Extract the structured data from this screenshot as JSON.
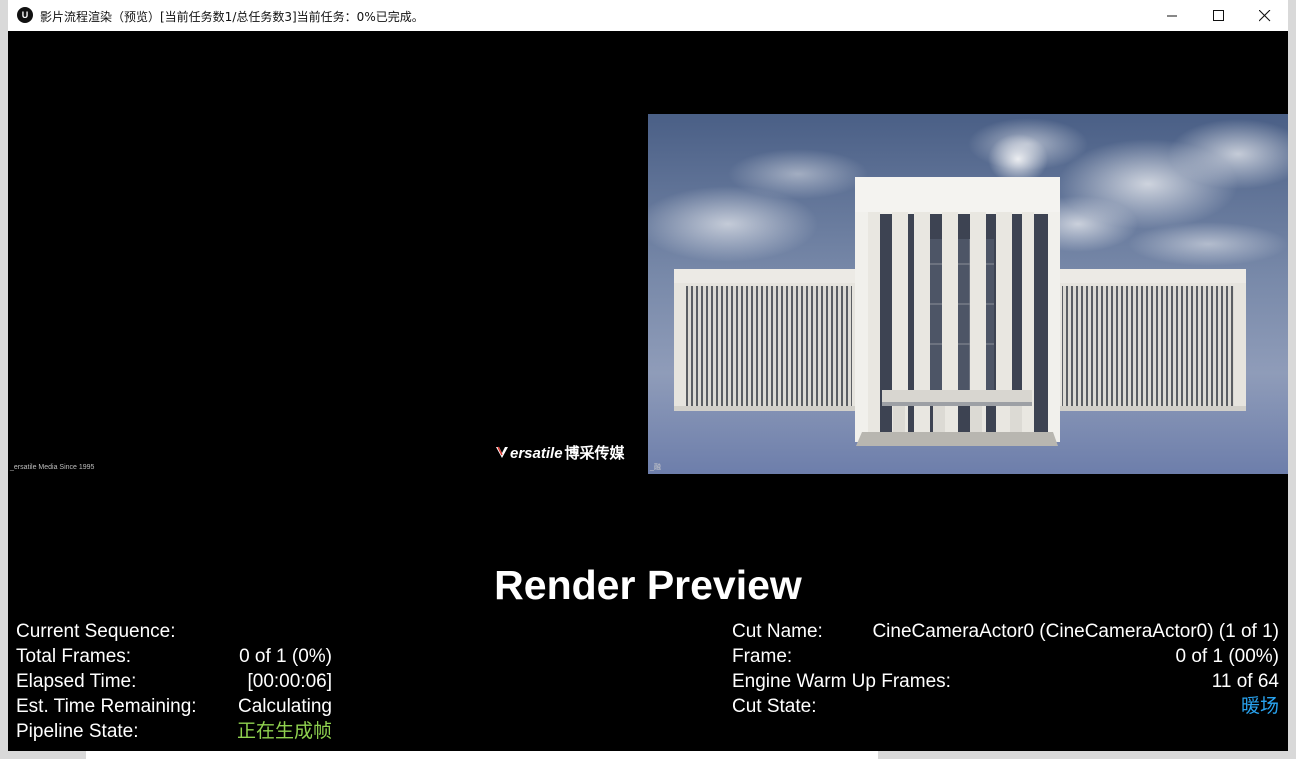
{
  "window": {
    "title": "影片流程渲染（预览）[当前任务数1/总任务数3]当前任务：0%已完成。",
    "logo_text": "U",
    "controls": [
      "minimize-icon",
      "maximize-icon",
      "close-icon"
    ]
  },
  "overlay": {
    "left_caption": "_ersatile Media Since 1995",
    "brand_name": "ersatile",
    "brand_cn": "博采传媒",
    "preview_caption": "_融"
  },
  "heading": "Render Preview",
  "stats_left": [
    {
      "label": "Current Sequence:",
      "value": ""
    },
    {
      "label": "Total Frames:",
      "value": "0 of 1 (0%)"
    },
    {
      "label": "Elapsed Time:",
      "value": "[00:00:06]"
    },
    {
      "label": "Est. Time Remaining:",
      "value": "Calculating"
    },
    {
      "label": "Pipeline State:",
      "value": "正在生成帧"
    }
  ],
  "stats_right": [
    {
      "label": "Cut Name:",
      "value": "CineCameraActor0 (CineCameraActor0) (1 of 1)"
    },
    {
      "label": "Frame:",
      "value": "0 of 1 (00%)"
    },
    {
      "label": "Engine Warm Up Frames:",
      "value": "11 of 64"
    },
    {
      "label": "Cut State:",
      "value": "暖场"
    }
  ],
  "colors": {
    "pipeline_state": "#8fd14f",
    "cut_state": "#29a3f0",
    "background": "#000000"
  }
}
